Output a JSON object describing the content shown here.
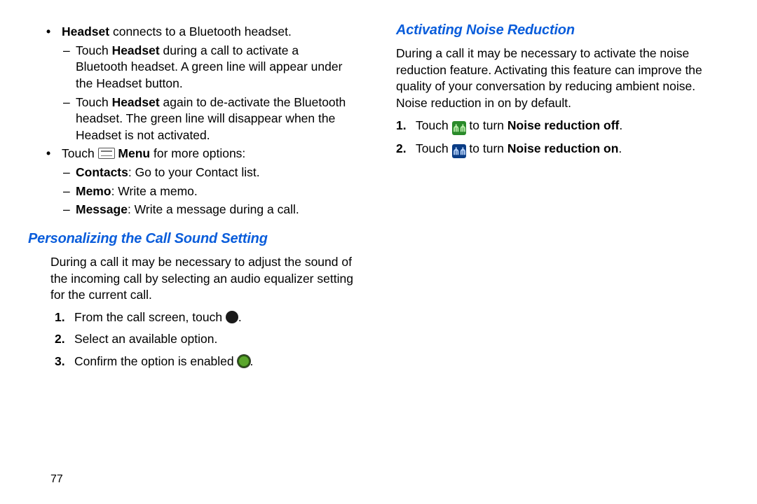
{
  "page_number": "77",
  "left": {
    "bullet1": {
      "lead": "Headset",
      "text": " connects to a Bluetooth headset."
    },
    "sub1a": {
      "pre": "Touch ",
      "bold": "Headset",
      "post": " during a call to activate a Bluetooth headset. A green line will appear under the Headset button."
    },
    "sub1b": {
      "pre": "Touch ",
      "bold": "Headset",
      "post": " again to de-activate the Bluetooth headset. The green line will disappear when the Headset is not activated."
    },
    "bullet2": {
      "pre": "Touch ",
      "bold": " Menu",
      "post": " for more options:"
    },
    "sub2a": {
      "bold": "Contacts",
      "post": ": Go to your Contact list."
    },
    "sub2b": {
      "bold": "Memo",
      "post": ": Write a memo."
    },
    "sub2c": {
      "bold": "Message",
      "post": ": Write a message during a call."
    },
    "heading": "Personalizing the Call Sound Setting",
    "para": "During a call it may be necessary to adjust the sound of the incoming call by selecting an audio equalizer setting for the current call.",
    "step1_pre": "From the call screen, touch ",
    "step1_post": ".",
    "step2": "Select an available option.",
    "step3_pre": "Confirm the option is enabled ",
    "step3_post": "."
  },
  "right": {
    "heading": "Activating Noise Reduction",
    "para": "During a call it may be necessary to activate the noise reduction feature. Activating this feature can improve the quality of your conversation by reducing ambient noise. Noise reduction in on by default.",
    "step1_pre": "Touch ",
    "step1_mid": " to turn ",
    "step1_bold": "Noise reduction off",
    "step1_post": ".",
    "step2_pre": "Touch ",
    "step2_mid": " to turn ",
    "step2_bold": "Noise reduction on",
    "step2_post": "."
  }
}
